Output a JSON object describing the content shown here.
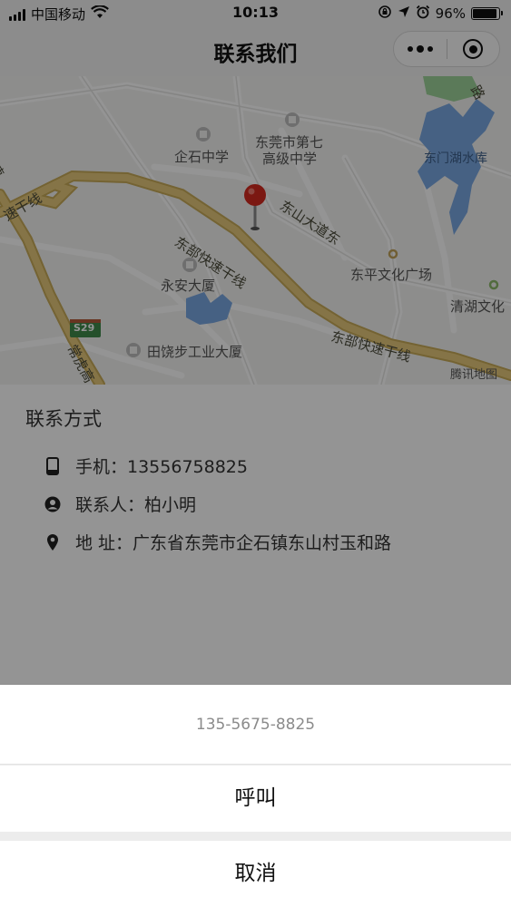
{
  "status_bar": {
    "carrier": "中国移动",
    "time": "10:13",
    "battery": "96%",
    "battery_level": 0.96
  },
  "nav": {
    "title": "联系我们"
  },
  "map": {
    "pois": {
      "qishi_school": "企石中学",
      "dongguan7_line1": "东莞市第七",
      "dongguan7_line2": "高级中学",
      "reservoir": "东门湖水库",
      "yongan": "永安大厦",
      "dongping": "东平文化广场",
      "qinghu": "清湖文化",
      "tianrao": "田饶步工业大厦",
      "tencent": "腾讯地图",
      "s29": "S29"
    },
    "roads": {
      "dongbu1": "东部快速干线",
      "dongbu2": "东部快速干线",
      "dongshan": "东山大道东",
      "left_line": "速干线",
      "left_edge": "速",
      "changhu": "常虎高",
      "top_right": "路"
    },
    "colors": {
      "highway": "#e6c97a",
      "water": "#79a7e2",
      "green": "#9ed39a",
      "pin": "#d42a1f"
    }
  },
  "contact": {
    "title": "联系方式",
    "phone_label": "手机：13556758825",
    "person_label": "联系人：柏小明",
    "address_label": "地 址：广东省东莞市企石镇东山村玉和路"
  },
  "sheet": {
    "number": "135-5675-8825",
    "call": "呼叫",
    "cancel": "取消"
  }
}
